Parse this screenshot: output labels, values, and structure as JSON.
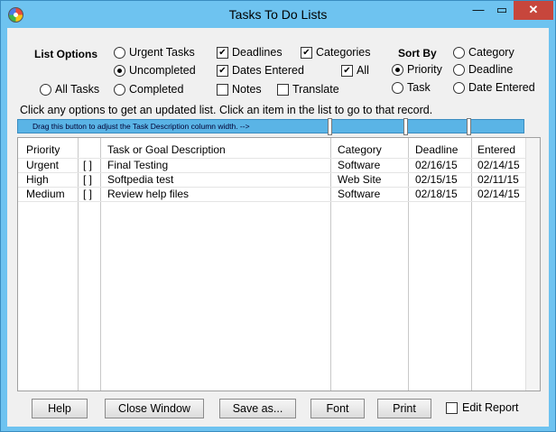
{
  "window": {
    "title": "Tasks To Do Lists",
    "minimize_glyph": "—",
    "maximize_glyph": "▭",
    "close_glyph": "✕"
  },
  "list_options": {
    "label": "List Options",
    "urgent_tasks": {
      "label": "Urgent Tasks",
      "selected": false
    },
    "uncompleted": {
      "label": "Uncompleted",
      "selected": true
    },
    "all_tasks": {
      "label": "All Tasks",
      "selected": false
    },
    "completed": {
      "label": "Completed",
      "selected": false
    }
  },
  "columns_options": {
    "deadlines": {
      "label": "Deadlines",
      "checked": true
    },
    "dates_entered": {
      "label": "Dates Entered",
      "checked": true
    },
    "notes": {
      "label": "Notes",
      "checked": false
    },
    "categories": {
      "label": "Categories",
      "checked": true
    },
    "all": {
      "label": "All",
      "checked": true
    },
    "translate": {
      "label": "Translate",
      "checked": false
    }
  },
  "sort_by": {
    "label": "Sort By",
    "priority": {
      "label": "Priority",
      "selected": true
    },
    "task": {
      "label": "Task",
      "selected": false
    },
    "category": {
      "label": "Category",
      "selected": false
    },
    "deadline": {
      "label": "Deadline",
      "selected": false
    },
    "date_entered": {
      "label": "Date Entered",
      "selected": false
    }
  },
  "hint": "Click any options to get an updated list. Click an item in the list to go to that record.",
  "drag_bar": "Drag this button to adjust the Task Description column width. -->",
  "table": {
    "headers": {
      "priority": "Priority",
      "task": "Task or Goal Description",
      "category": "Category",
      "deadline": "Deadline",
      "entered": "Entered"
    },
    "rows": [
      {
        "priority": "Urgent",
        "done": "[ ]",
        "task": "Final Testing",
        "category": "Software",
        "deadline": "02/16/15",
        "entered": "02/14/15"
      },
      {
        "priority": "High",
        "done": "[ ]",
        "task": "Softpedia test",
        "category": "Web Site",
        "deadline": "02/15/15",
        "entered": "02/11/15"
      },
      {
        "priority": "Medium",
        "done": "[ ]",
        "task": "Review help files",
        "category": "Software",
        "deadline": "02/18/15",
        "entered": "02/14/15"
      }
    ]
  },
  "buttons": {
    "help": "Help",
    "close_window": "Close Window",
    "save_as": "Save as...",
    "font": "Font",
    "print": "Print"
  },
  "edit_report": {
    "label": "Edit Report",
    "checked": false
  },
  "colors": {
    "titlebar": "#6ec3f0",
    "close": "#c7463c",
    "dragbar": "#5ab4e6"
  }
}
